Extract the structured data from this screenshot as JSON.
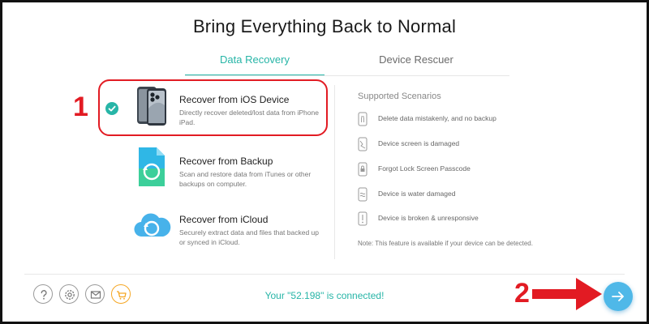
{
  "title": "Bring Everything Back to Normal",
  "tabs": [
    {
      "label": "Data Recovery",
      "active": true
    },
    {
      "label": "Device Rescuer",
      "active": false
    }
  ],
  "options": [
    {
      "title": "Recover from iOS Device",
      "desc": "Directly recover deleted/lost data from iPhone iPad.",
      "icon": "iphone-icon",
      "selected": true
    },
    {
      "title": "Recover from Backup",
      "desc": "Scan and restore data from iTunes or other backups on computer.",
      "icon": "backup-file-icon",
      "selected": false
    },
    {
      "title": "Recover from iCloud",
      "desc": "Securely extract data and files that backed up or synced in iCloud.",
      "icon": "icloud-icon",
      "selected": false
    }
  ],
  "scenarios": {
    "header": "Supported Scenarios",
    "items": [
      {
        "label": "Delete data mistakenly, and no backup",
        "icon": "trash-icon"
      },
      {
        "label": "Device screen is damaged",
        "icon": "broken-screen-icon"
      },
      {
        "label": "Forgot Lock Screen Passcode",
        "icon": "lock-icon"
      },
      {
        "label": "Device is water damaged",
        "icon": "water-icon"
      },
      {
        "label": "Device is broken & unresponsive",
        "icon": "broken-device-icon"
      }
    ],
    "note": "Note: This feature is available if your device can be detected."
  },
  "status": "Your \"52.198\" is connected!",
  "annotations": {
    "step1": "1",
    "step2": "2"
  },
  "colors": {
    "accent": "#27b5a7",
    "highlight": "#e21b23",
    "next_button": "#4fb8e8",
    "cart": "#f5a623"
  },
  "footer_icons": [
    "help-icon",
    "settings-icon",
    "mail-icon",
    "cart-icon"
  ]
}
